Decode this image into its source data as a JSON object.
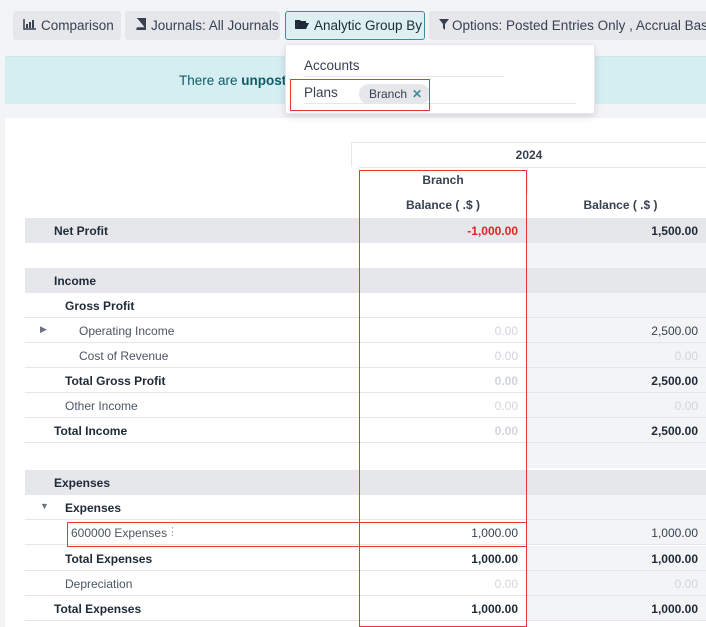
{
  "toolbar": {
    "comparison": {
      "icon": "bar-chart-icon",
      "label": "Comparison"
    },
    "journals": {
      "icon": "book-icon",
      "label": "Journals: All Journals"
    },
    "analytic": {
      "icon": "folder-open-icon",
      "label": "Analytic Group By"
    },
    "options": {
      "icon": "filter-icon",
      "label": "Options: Posted Entries Only , Accrual Basis"
    }
  },
  "banner": {
    "prefix": "There are",
    "bold": "unposted"
  },
  "dropdown": {
    "accounts_label": "Accounts",
    "plans_label": "Plans",
    "tag_label": "Branch",
    "tag_remove": "✕"
  },
  "report": {
    "year": "2024",
    "group_header": "Branch",
    "balance_header_1": "Balance ( .$ )",
    "balance_header_2": "Balance ( .$ )",
    "rows": [
      {
        "label": "Net Profit",
        "v1": "-1,000.00",
        "v2": "1,500.00"
      },
      {
        "label": "Income"
      },
      {
        "label": "Gross Profit"
      },
      {
        "label": "Operating Income",
        "v1": "0.00",
        "v2": "2,500.00"
      },
      {
        "label": "Cost of Revenue",
        "v1": "0.00",
        "v2": "0.00"
      },
      {
        "label": "Total Gross Profit",
        "v1": "0.00",
        "v2": "2,500.00"
      },
      {
        "label": "Other Income",
        "v1": "0.00",
        "v2": "0.00"
      },
      {
        "label": "Total Income",
        "v1": "0.00",
        "v2": "2,500.00"
      },
      {
        "label": "Expenses"
      },
      {
        "label": "Expenses"
      },
      {
        "label": "600000 Expenses",
        "v1": "1,000.00",
        "v2": "1,000.00"
      },
      {
        "label": "Total Expenses",
        "v1": "1,000.00",
        "v2": "1,000.00"
      },
      {
        "label": "Depreciation",
        "v1": "0.00",
        "v2": "0.00"
      },
      {
        "label": "Total Expenses",
        "v1": "1,000.00",
        "v2": "1,000.00"
      }
    ]
  },
  "colors": {
    "accent": "#3b8f98",
    "negative": "#dc2626",
    "highlight": "#e53935",
    "banner": "#d4eef1"
  }
}
